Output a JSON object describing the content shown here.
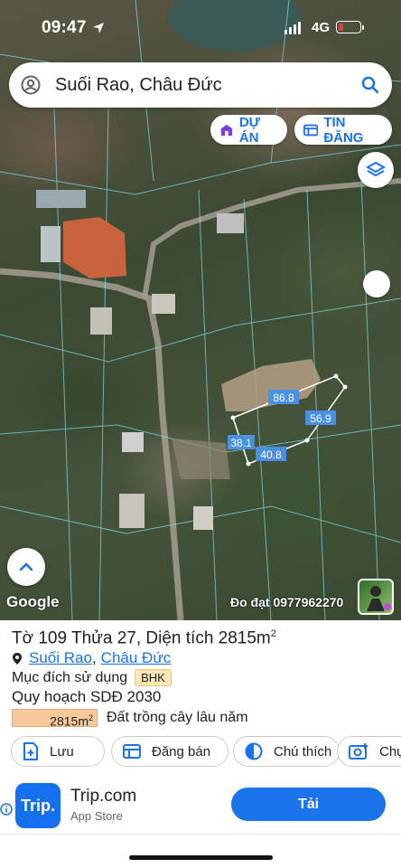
{
  "status_bar": {
    "time": "09:47",
    "network": "4G"
  },
  "search": {
    "query": "Suối Rao, Châu Đức"
  },
  "chips": {
    "du_an": "DỰ ÁN",
    "tin_dang": "TIN ĐĂNG"
  },
  "map": {
    "attribution": "Google",
    "measurer": "Đo đạt 0977962270",
    "plot_edges": [
      "86.8",
      "56.9",
      "38.1",
      "40.8"
    ],
    "highlight_color": "#4a90e2"
  },
  "parcel": {
    "title": "Tờ 109 Thửa 27, Diện tích 2815m",
    "title_sup": "2",
    "ward": "Suối Rao",
    "district": "Châu Đức",
    "purpose_label": "Mục đích sử dụng",
    "purpose_code": "BHK",
    "plan_label": "Quy hoạch SDĐ 2030",
    "plan_area": "2815m",
    "plan_area_sup": "2",
    "plan_type": "Đất trồng cây lâu năm"
  },
  "actions": {
    "save": "Lưu",
    "post_sale": "Đăng bán",
    "legend": "Chú thích",
    "capture": "Chụp"
  },
  "ad": {
    "logo": "Trip.",
    "name": "Trip.com",
    "store": "App Store",
    "cta": "Tải"
  }
}
